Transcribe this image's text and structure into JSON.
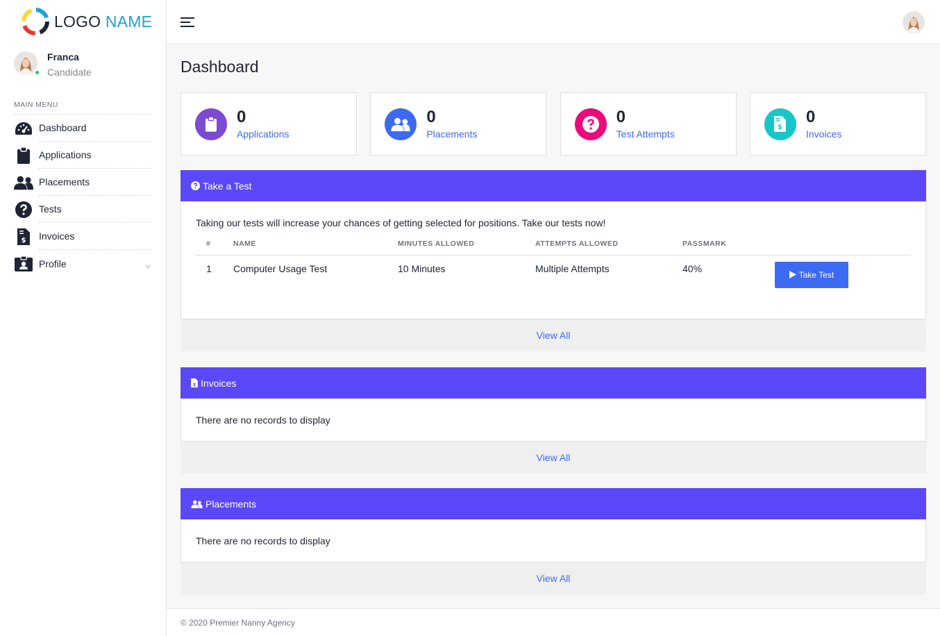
{
  "brand": {
    "logo_word1": "LOGO",
    "logo_word2": "NAME",
    "accent": "#1ba3d8"
  },
  "user": {
    "name": "Franca",
    "role": "Candidate",
    "status_color": "#28c76f"
  },
  "sidebar": {
    "heading": "MAIN MENU",
    "items": [
      {
        "label": "Dashboard",
        "icon": "dashboard-gauge-icon"
      },
      {
        "label": "Applications",
        "icon": "clipboard-icon"
      },
      {
        "label": "Placements",
        "icon": "users-icon"
      },
      {
        "label": "Tests",
        "icon": "question-circle-icon"
      },
      {
        "label": "Invoices",
        "icon": "invoice-file-icon"
      },
      {
        "label": "Profile",
        "icon": "id-badge-icon",
        "has_dropdown": true
      }
    ]
  },
  "page": {
    "title": "Dashboard"
  },
  "stats": [
    {
      "count": "0",
      "label": "Applications",
      "color": "#7b4bd1",
      "icon": "clipboard-icon"
    },
    {
      "count": "0",
      "label": "Placements",
      "color": "#3d6af2",
      "icon": "users-icon"
    },
    {
      "count": "0",
      "label": "Test Attempts",
      "color": "#ea0a7c",
      "icon": "question-circle-icon"
    },
    {
      "count": "0",
      "label": "Invoices",
      "color": "#17c7c7",
      "icon": "invoice-file-icon"
    }
  ],
  "tests_panel": {
    "title": "Take a Test",
    "intro": "Taking our tests will increase your chances of getting selected for positions. Take our tests now!",
    "columns": [
      "#",
      "NAME",
      "MINUTES ALLOWED",
      "ATTEMPTS ALLOWED",
      "PASSMARK"
    ],
    "rows": [
      {
        "num": "1",
        "name": "Computer Usage Test",
        "minutes": "10 Minutes",
        "attempts": "Multiple Attempts",
        "passmark": "40%",
        "action": "Take Test"
      }
    ],
    "view_all": "View All"
  },
  "invoices_panel": {
    "title": "Invoices",
    "empty": "There are no records to display",
    "view_all": "View All"
  },
  "placements_panel": {
    "title": "Placements",
    "empty": "There are no records to display",
    "view_all": "View All"
  },
  "footer": {
    "text": "© 2020 Premier Nanny Agency"
  },
  "colors": {
    "panel_header": "#5b48fa",
    "link": "#3d6af2"
  }
}
